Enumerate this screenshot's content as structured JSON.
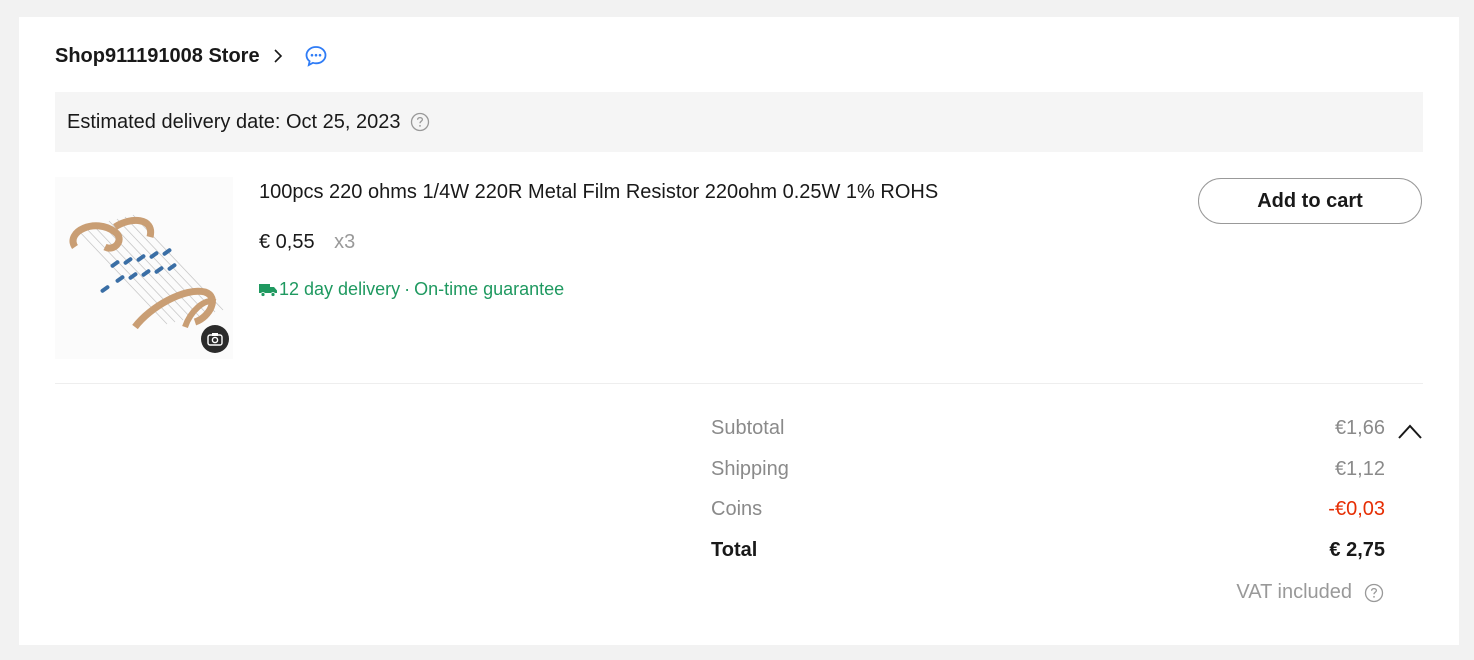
{
  "store": {
    "name": "Shop911191008 Store"
  },
  "delivery": {
    "text": "Estimated delivery date: Oct 25, 2023"
  },
  "product": {
    "title": "100pcs 220 ohms 1/4W 220R Metal Film Resistor 220ohm 0.25W 1% ROHS",
    "price": "€ 0,55",
    "quantity": "x3",
    "shipping_days": "12 day delivery",
    "separator": "·",
    "guarantee": "On-time guarantee",
    "add_to_cart_label": "Add to cart"
  },
  "summary": {
    "rows": [
      {
        "label": "Subtotal",
        "value": "€1,66"
      },
      {
        "label": "Shipping",
        "value": "€1,12"
      },
      {
        "label": "Coins",
        "value": "-€0,03"
      },
      {
        "label": "Total",
        "value": "€ 2,75"
      }
    ],
    "vat_label": "VAT included"
  },
  "colors": {
    "accent_green": "#1f9960",
    "discount_red": "#e62e04",
    "chat_blue": "#2f7cf6"
  },
  "icons": [
    "chevron-right-icon",
    "chat-icon",
    "help-icon",
    "camera-icon",
    "truck-icon",
    "chevron-up-icon"
  ]
}
